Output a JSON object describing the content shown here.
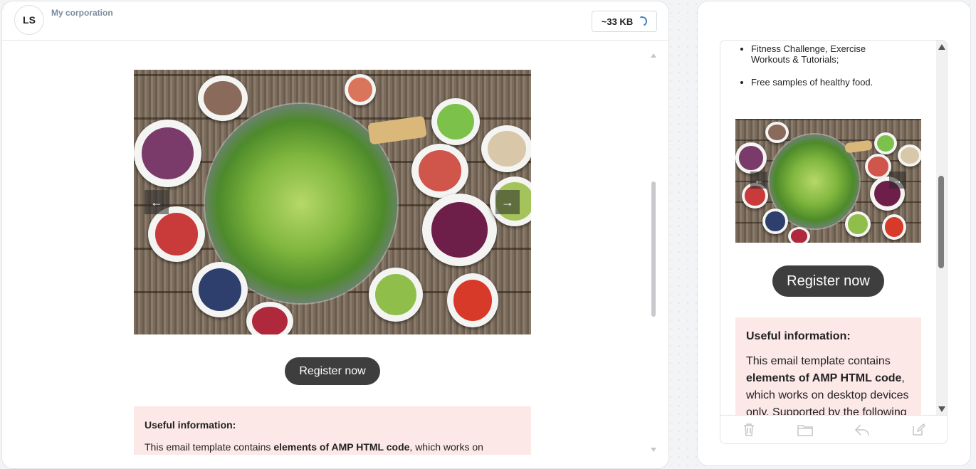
{
  "header": {
    "avatar_initials": "LS",
    "sender_name": "My corporation",
    "size_badge": "~33 KB"
  },
  "desktop": {
    "image": {
      "description_icon": "salad-image",
      "prev_icon": "arrow-left-icon",
      "next_icon": "arrow-right-icon"
    },
    "register_label": "Register now",
    "info": {
      "title": "Useful information:",
      "text_before": "This email template contains ",
      "text_bold": "elements of AMP HTML code",
      "text_after": ", which works on"
    }
  },
  "mobile": {
    "bullets": [
      "Fitness Challenge, Exercise Workouts & Tutorials;",
      "Free samples of healthy food."
    ],
    "register_label": "Register now",
    "info": {
      "title": "Useful information:",
      "text_before": "This email template contains ",
      "text_bold": "elements of AMP HTML code",
      "text_after": ", which works on desktop devices only. Supported by the following"
    },
    "toolbar": [
      "trash-icon",
      "folder-icon",
      "reply-icon",
      "edit-icon"
    ]
  },
  "colors": {
    "button_bg": "#3e3e3e",
    "info_bg": "#fde8e8",
    "sender_text": "#7a8b9a",
    "spinner": "#3b82c4"
  }
}
